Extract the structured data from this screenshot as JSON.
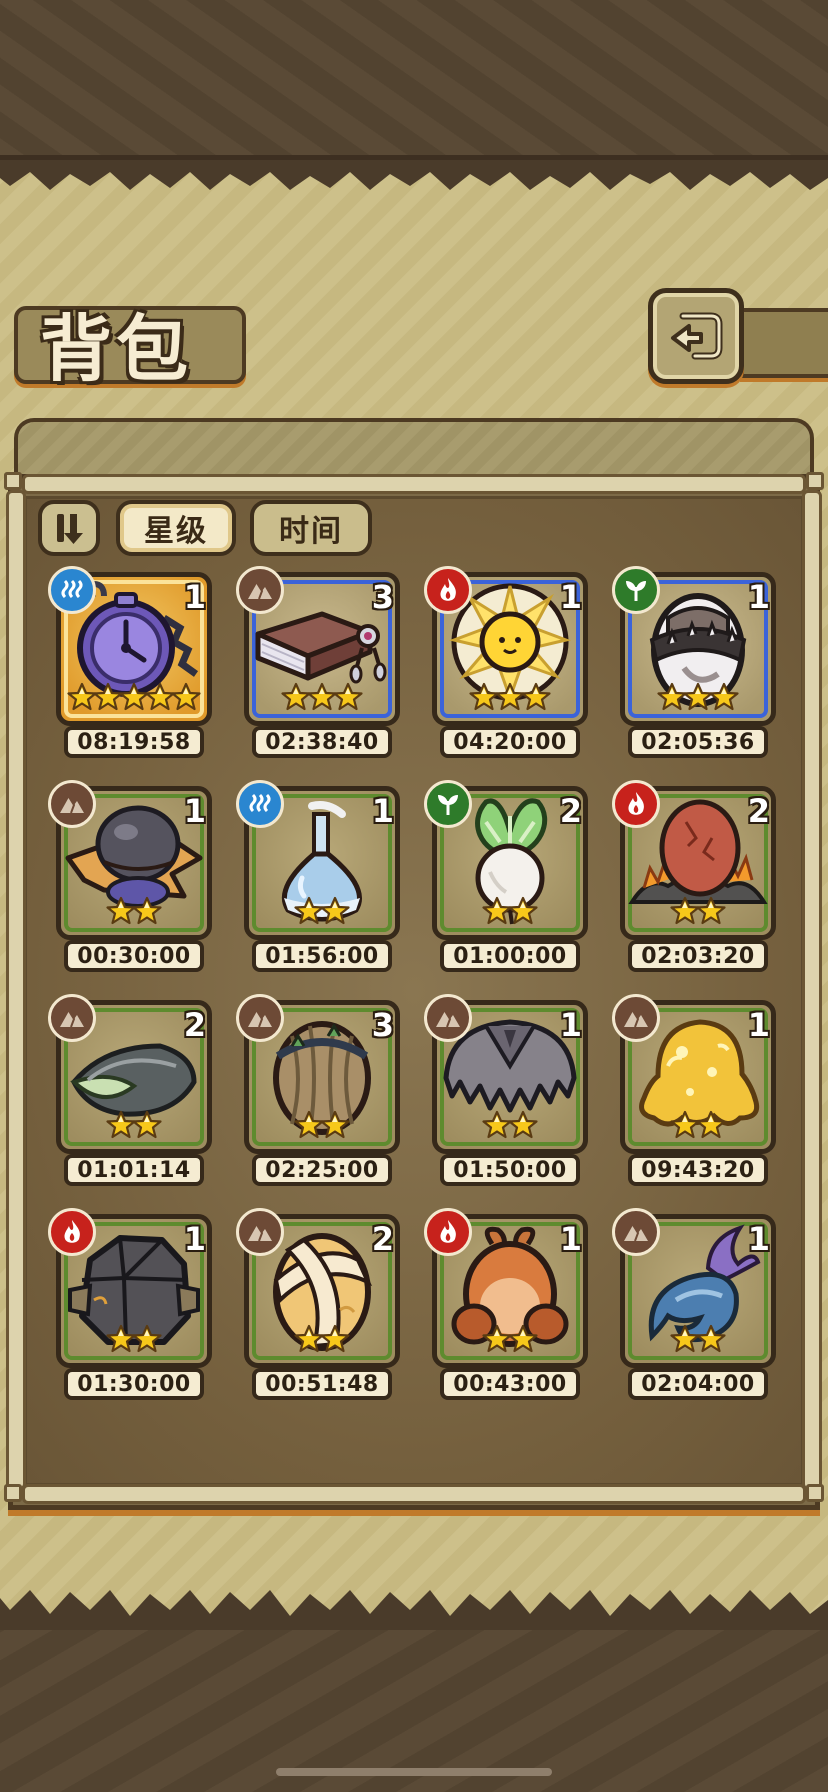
{
  "header": {
    "title": "背包",
    "back_label": "back"
  },
  "tabs": {
    "star_label": "星级",
    "time_label": "时间"
  },
  "colors": {
    "gold": "#e09a2a",
    "blue": "#3b63d9",
    "green": "#5e8b2e",
    "star": "#f7c81a"
  },
  "items": [
    {
      "name": "purple pocket watch",
      "element": "water",
      "rarity": "gold",
      "count": "1",
      "stars": 5,
      "time": "08:19:58",
      "art": "watch"
    },
    {
      "name": "book with pendant",
      "element": "earth",
      "rarity": "blue",
      "count": "3",
      "stars": 3,
      "time": "02:38:40",
      "art": "book"
    },
    {
      "name": "sun orb",
      "element": "fire",
      "rarity": "blue",
      "count": "1",
      "stars": 3,
      "time": "04:20:00",
      "art": "sun"
    },
    {
      "name": "spiked collar egg",
      "element": "nature",
      "rarity": "blue",
      "count": "1",
      "stars": 3,
      "time": "02:05:36",
      "art": "collar"
    },
    {
      "name": "hat egg",
      "element": "earth",
      "rarity": "green",
      "count": "1",
      "stars": 2,
      "time": "00:30:00",
      "art": "hat"
    },
    {
      "name": "blue flask",
      "element": "water",
      "rarity": "green",
      "count": "1",
      "stars": 2,
      "time": "01:56:00",
      "art": "flask"
    },
    {
      "name": "turnip",
      "element": "nature",
      "rarity": "green",
      "count": "2",
      "stars": 2,
      "time": "01:00:00",
      "art": "turnip"
    },
    {
      "name": "lava egg",
      "element": "fire",
      "rarity": "green",
      "count": "2",
      "stars": 2,
      "time": "02:03:20",
      "art": "lava"
    },
    {
      "name": "leaf cocoon",
      "element": "earth",
      "rarity": "green",
      "count": "2",
      "stars": 2,
      "time": "01:01:14",
      "art": "leaf"
    },
    {
      "name": "wrapped egg",
      "element": "earth",
      "rarity": "green",
      "count": "3",
      "stars": 2,
      "time": "02:25:00",
      "art": "wrapped"
    },
    {
      "name": "grey fur",
      "element": "earth",
      "rarity": "green",
      "count": "1",
      "stars": 2,
      "time": "01:50:00",
      "art": "fur"
    },
    {
      "name": "golden slime egg",
      "element": "earth",
      "rarity": "green",
      "count": "1",
      "stars": 2,
      "time": "09:43:20",
      "art": "slime"
    },
    {
      "name": "stone armor",
      "element": "fire",
      "rarity": "green",
      "count": "1",
      "stars": 2,
      "time": "01:30:00",
      "art": "rock"
    },
    {
      "name": "bandaged egg",
      "element": "earth",
      "rarity": "green",
      "count": "2",
      "stars": 2,
      "time": "00:51:48",
      "art": "bandage"
    },
    {
      "name": "orange critter",
      "element": "fire",
      "rarity": "green",
      "count": "1",
      "stars": 2,
      "time": "00:43:00",
      "art": "critter"
    },
    {
      "name": "fish tail",
      "element": "earth",
      "rarity": "green",
      "count": "1",
      "stars": 2,
      "time": "02:04:00",
      "art": "fish"
    }
  ]
}
